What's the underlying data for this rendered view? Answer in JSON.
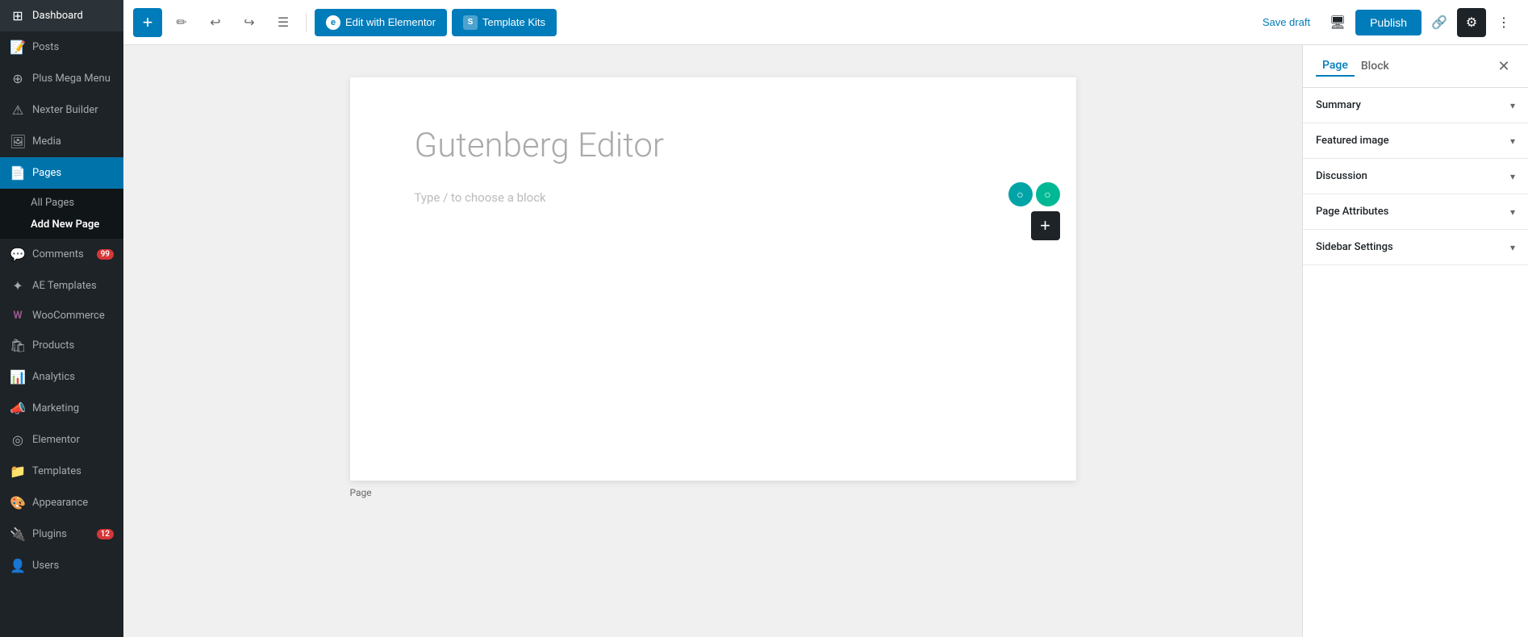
{
  "sidebar": {
    "items": [
      {
        "id": "dashboard",
        "label": "Dashboard",
        "icon": "⊞"
      },
      {
        "id": "posts",
        "label": "Posts",
        "icon": "📝"
      },
      {
        "id": "plus-mega-menu",
        "label": "Plus Mega Menu",
        "icon": "⊕"
      },
      {
        "id": "nexter-builder",
        "label": "Nexter Builder",
        "icon": "⚠"
      },
      {
        "id": "media",
        "label": "Media",
        "icon": "🖼"
      },
      {
        "id": "pages",
        "label": "Pages",
        "icon": "📄",
        "active": true
      },
      {
        "id": "comments",
        "label": "Comments",
        "icon": "💬",
        "badge": "99"
      },
      {
        "id": "ae-templates",
        "label": "AE Templates",
        "icon": "✦"
      },
      {
        "id": "woocommerce",
        "label": "WooCommerce",
        "icon": "W"
      },
      {
        "id": "products",
        "label": "Products",
        "icon": "🛍"
      },
      {
        "id": "analytics",
        "label": "Analytics",
        "icon": "📊"
      },
      {
        "id": "marketing",
        "label": "Marketing",
        "icon": "📣"
      },
      {
        "id": "elementor",
        "label": "Elementor",
        "icon": "◎"
      },
      {
        "id": "templates",
        "label": "Templates",
        "icon": "📁"
      },
      {
        "id": "appearance",
        "label": "Appearance",
        "icon": "🎨"
      },
      {
        "id": "plugins",
        "label": "Plugins",
        "icon": "🔌",
        "badge": "12"
      },
      {
        "id": "users",
        "label": "Users",
        "icon": "👤"
      }
    ],
    "pages_sub": [
      {
        "id": "all-pages",
        "label": "All Pages"
      },
      {
        "id": "add-new-page",
        "label": "Add New Page",
        "active": true
      }
    ]
  },
  "toolbar": {
    "add_label": "+",
    "edit_with_elementor": "Edit with Elementor",
    "template_kits": "Template Kits",
    "save_draft": "Save draft",
    "publish": "Publish"
  },
  "editor": {
    "title_placeholder": "Gutenberg Editor",
    "block_placeholder": "Type / to choose a block",
    "footer_label": "Page"
  },
  "right_panel": {
    "tab_page": "Page",
    "tab_block": "Block",
    "sections": [
      {
        "id": "summary",
        "label": "Summary"
      },
      {
        "id": "featured-image",
        "label": "Featured image"
      },
      {
        "id": "discussion",
        "label": "Discussion"
      },
      {
        "id": "page-attributes",
        "label": "Page Attributes"
      },
      {
        "id": "sidebar-settings",
        "label": "Sidebar Settings"
      }
    ]
  }
}
